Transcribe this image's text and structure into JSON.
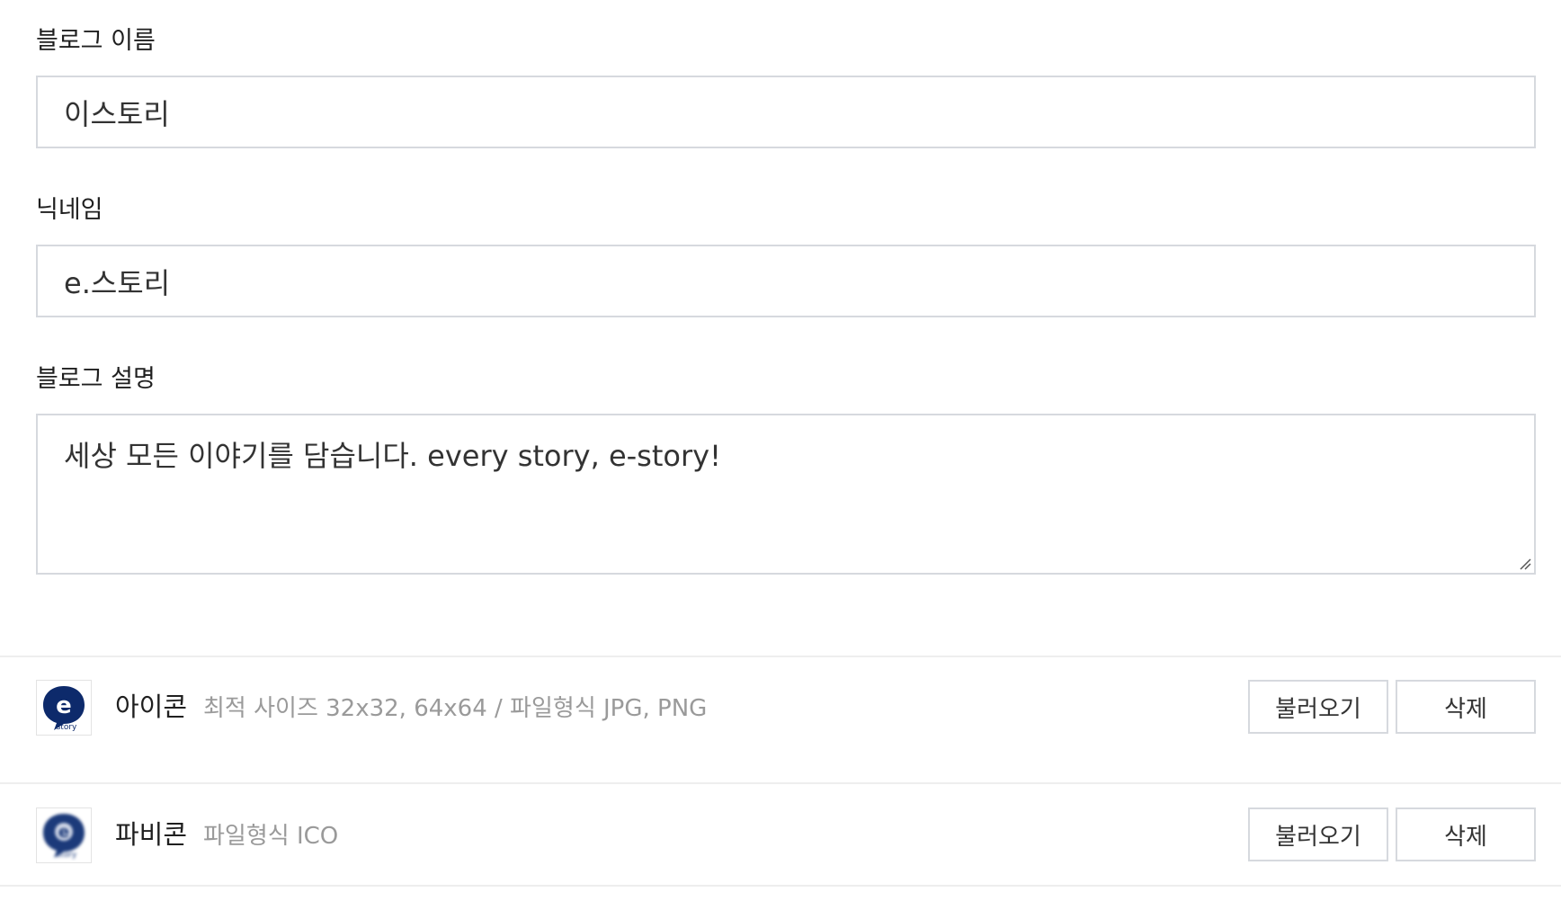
{
  "fields": {
    "blog_name": {
      "label": "블로그 이름",
      "value": "이스토리"
    },
    "nickname": {
      "label": "닉네임",
      "value": "e.스토리"
    },
    "description": {
      "label": "블로그 설명",
      "value": "세상 모든 이야기를 담습니다. every story, e-story!"
    }
  },
  "assets": {
    "icon": {
      "title": "아이콘",
      "hint": "최적 사이즈 32x32, 64x64 / 파일형식 JPG, PNG",
      "load_label": "불러오기",
      "delete_label": "삭제",
      "image_icon": "e-story-logo-icon"
    },
    "favicon": {
      "title": "파비콘",
      "hint": "파일형식 ICO",
      "load_label": "불러오기",
      "delete_label": "삭제",
      "image_icon": "e-story-favicon-icon"
    }
  },
  "colors": {
    "logo_blue": "#0d2a6b",
    "border": "#d6d9de",
    "hint_text": "#9a9a9a"
  }
}
